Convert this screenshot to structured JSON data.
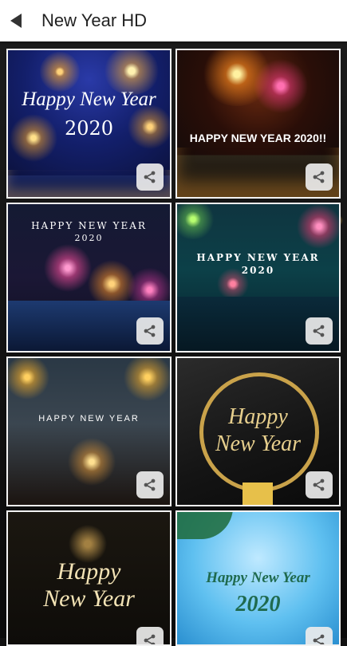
{
  "header": {
    "title": "New Year HD",
    "back_icon": "back-arrow-icon"
  },
  "cards": [
    {
      "id": "c1",
      "line1": "Happy New Year",
      "line2": "2020"
    },
    {
      "id": "c2",
      "line1": "HAPPY NEW YEAR 2020!!"
    },
    {
      "id": "c3",
      "line1": "HAPPY NEW YEAR",
      "line2": "2020"
    },
    {
      "id": "c4",
      "line1": "HAPPY NEW YEAR",
      "line2": "2020"
    },
    {
      "id": "c5",
      "line1": "HAPPY NEW YEAR"
    },
    {
      "id": "c6",
      "line1": "Happy",
      "line2": "New Year"
    },
    {
      "id": "c7",
      "line1": "Happy",
      "line2": "New Year"
    },
    {
      "id": "c8",
      "line1": "Happy New Year",
      "line2": "2020"
    }
  ],
  "share_icon": "share-icon"
}
